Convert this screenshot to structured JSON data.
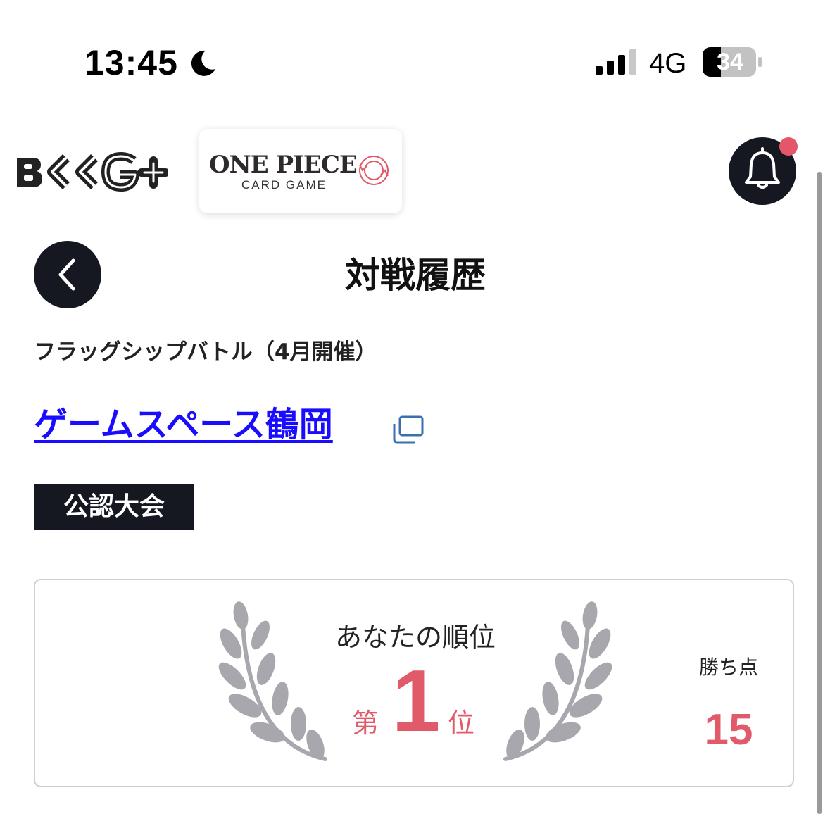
{
  "status_bar": {
    "time": "13:45",
    "network": "4G",
    "battery": "34"
  },
  "header": {
    "app_logo_text": "BCG+",
    "game_logo_title": "ONE PIECE",
    "game_logo_subtitle": "CARD GAME",
    "has_notification": true
  },
  "page": {
    "title": "対戦履歴",
    "event_name": "フラッグシップバトル（4月開催）",
    "shop_name": "ゲームスペース鶴岡",
    "badge": "公認大会"
  },
  "result": {
    "rank_label": "あなたの順位",
    "rank_prefix": "第",
    "rank_value": "1",
    "rank_suffix": "位",
    "points_label": "勝ち点",
    "points_value": "15"
  },
  "colors": {
    "accent_red": "#e05a6a",
    "dark": "#151820",
    "link_blue": "#1a0dff",
    "laurel_gray": "#a7a7ad"
  }
}
